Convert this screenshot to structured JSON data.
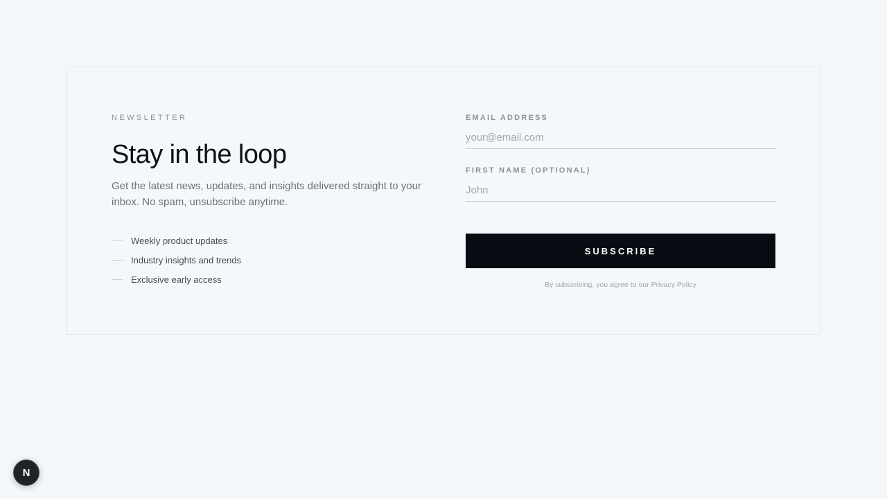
{
  "newsletter": {
    "eyebrow": "NEWSLETTER",
    "headline": "Stay in the loop",
    "description": "Get the latest news, updates, and insights delivered straight to your inbox. No spam, unsubscribe anytime.",
    "features": [
      "Weekly product updates",
      "Industry insights and trends",
      "Exclusive early access"
    ]
  },
  "form": {
    "email_label": "EMAIL ADDRESS",
    "email_placeholder": "your@email.com",
    "email_value": "",
    "name_label": "FIRST NAME (OPTIONAL)",
    "name_placeholder": "John",
    "name_value": "",
    "subscribe_label": "SUBSCRIBE",
    "legal_prefix": "By subscribing, you agree to our ",
    "legal_link": "Privacy Policy"
  },
  "dev_badge": {
    "letter": "N",
    "icon": "nextjs-logo-icon"
  },
  "colors": {
    "background": "#f4f8fb",
    "button": "#070b12",
    "border": "#e3e8ec"
  }
}
